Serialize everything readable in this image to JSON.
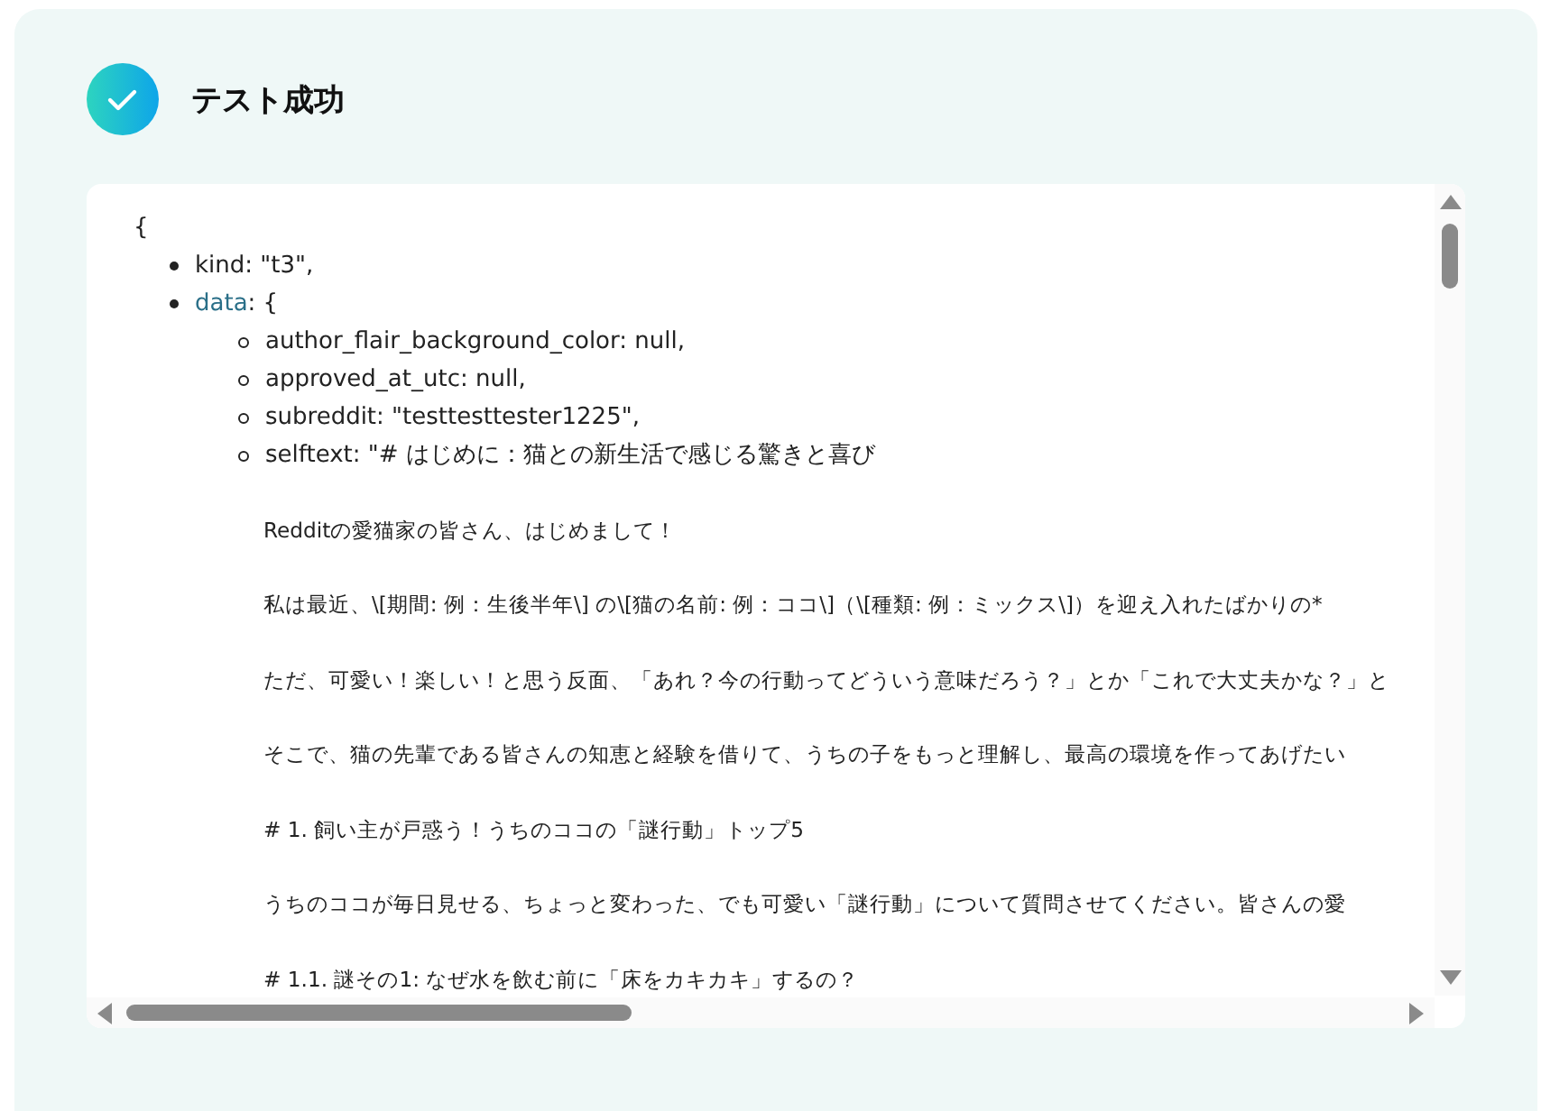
{
  "header": {
    "title": "テスト成功",
    "success": true
  },
  "output": {
    "open_brace": "{",
    "items": [
      {
        "kind": "text",
        "key": "kind",
        "value": ": \"t3\","
      },
      {
        "kind": "object",
        "key": "data",
        "value": ": {",
        "children": [
          {
            "key": "author_flair_background_color",
            "value": ": null,"
          },
          {
            "key": "approved_at_utc",
            "value": ": null,"
          },
          {
            "key": "subreddit",
            "value": ": \"testtesttester1225\","
          },
          {
            "key": "selftext",
            "value": ": \"# はじめに：猫との新生活で感じる驚きと喜び",
            "lines": [
              "Redditの愛猫家の皆さん、はじめまして！",
              "私は最近、\\[期間: 例：生後半年\\] の\\[猫の名前: 例：ココ\\]（\\[種類: 例：ミックス\\]）を迎え入れたばかりの*",
              "ただ、可愛い！楽しい！と思う反面、「あれ？今の行動ってどういう意味だろう？」とか「これで大丈夫かな？」と",
              "そこで、猫の先輩である皆さんの知恵と経験を借りて、うちの子をもっと理解し、最高の環境を作ってあげたい",
              "# 1. 飼い主が戸惑う！うちのココの「謎行動」トップ5",
              "うちのココが毎日見せる、ちょっと変わった、でも可愛い「謎行動」について質問させてください。皆さんの愛",
              "# 1.1. 謎その1: なぜ水を飲む前に「床をカキカキ」するの？"
            ]
          }
        ]
      }
    ]
  }
}
